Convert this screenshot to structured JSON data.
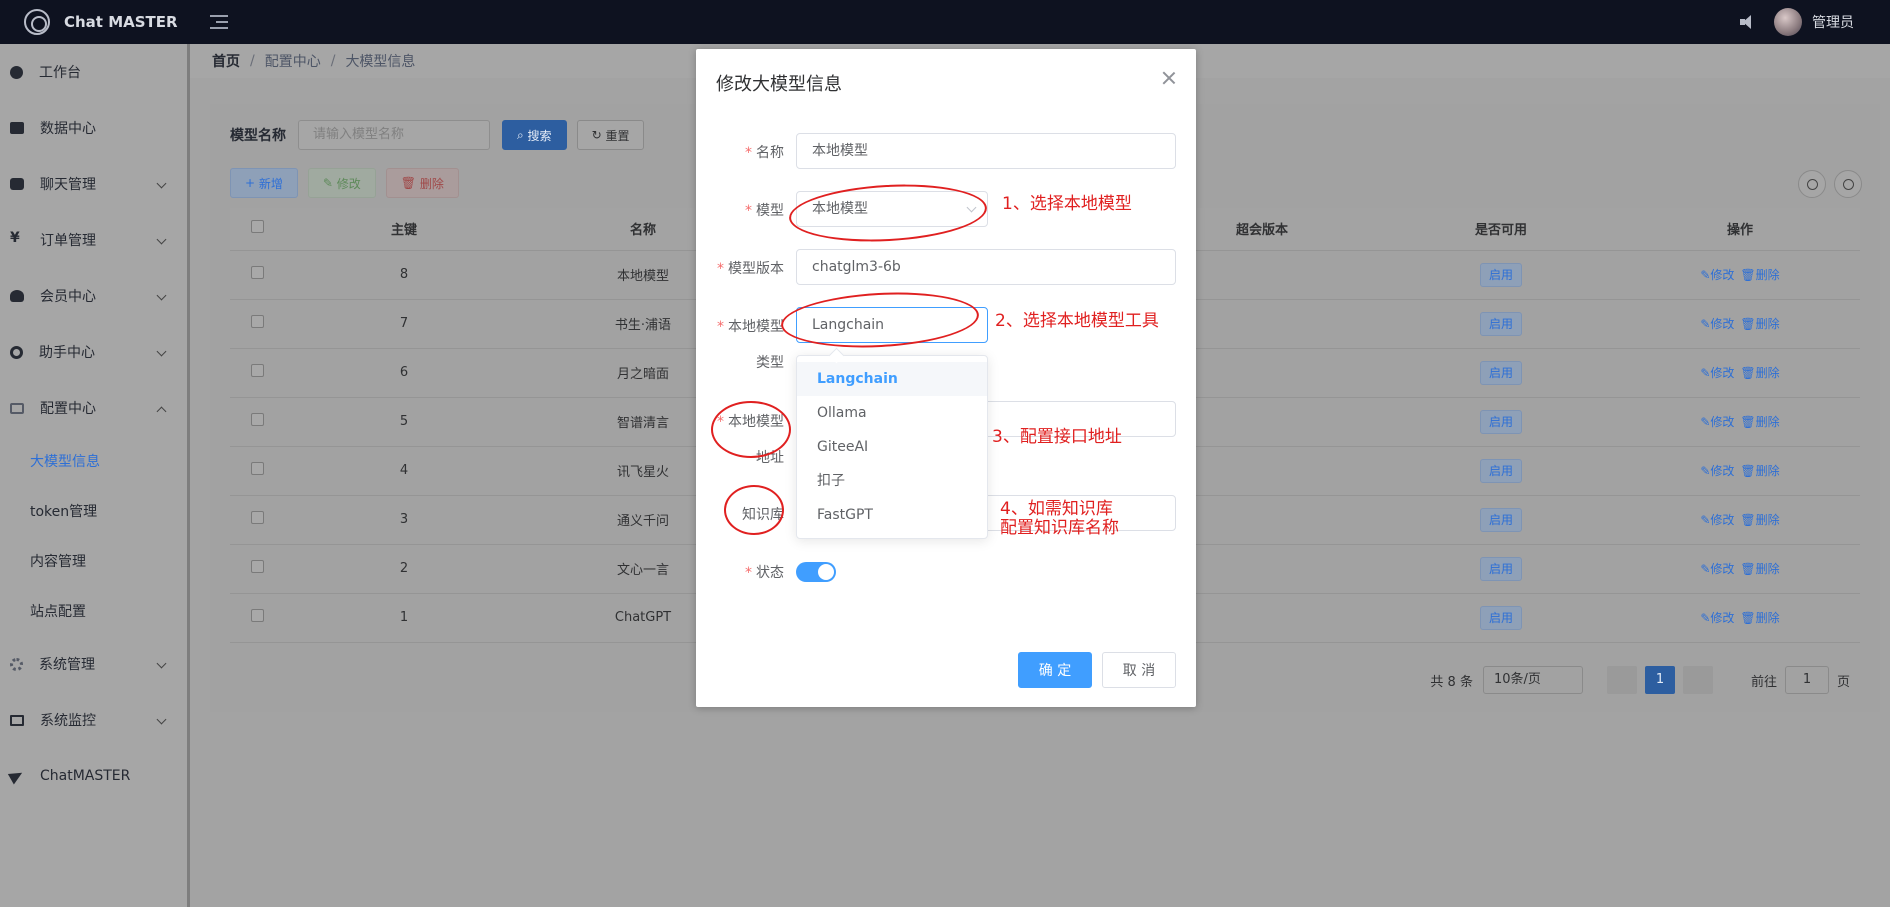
{
  "app": {
    "title": "Chat MASTER",
    "user": "管理员"
  },
  "sidebar": {
    "items": [
      {
        "label": "工作台"
      },
      {
        "label": "数据中心"
      },
      {
        "label": "聊天管理"
      },
      {
        "label": "订单管理"
      },
      {
        "label": "会员中心"
      },
      {
        "label": "助手中心"
      },
      {
        "label": "配置中心"
      },
      {
        "label": "系统管理"
      },
      {
        "label": "系统监控"
      },
      {
        "label": "ChatMASTER"
      }
    ],
    "sub_items": [
      {
        "label": "大模型信息"
      },
      {
        "label": "token管理"
      },
      {
        "label": "内容管理"
      },
      {
        "label": "站点配置"
      }
    ]
  },
  "breadcrumb": {
    "home": "首页",
    "section": "配置中心",
    "current": "大模型信息"
  },
  "search": {
    "label": "模型名称",
    "placeholder": "请输入模型名称",
    "search_btn": "搜索",
    "reset_btn": "重置"
  },
  "actions": {
    "add": "新增",
    "edit": "修改",
    "delete": "删除"
  },
  "table": {
    "headers": [
      "主键",
      "名称",
      "超会版本",
      "是否可用",
      "操作"
    ],
    "rows": [
      {
        "id": "8",
        "name": "本地模型",
        "status": "启用"
      },
      {
        "id": "7",
        "name": "书生·浦语",
        "status": "启用"
      },
      {
        "id": "6",
        "name": "月之暗面",
        "status": "启用"
      },
      {
        "id": "5",
        "name": "智谱清言",
        "status": "启用"
      },
      {
        "id": "4",
        "name": "讯飞星火",
        "status": "启用"
      },
      {
        "id": "3",
        "name": "通义千问",
        "status": "启用"
      },
      {
        "id": "2",
        "name": "文心一言",
        "status": "启用"
      },
      {
        "id": "1",
        "name": "ChatGPT",
        "status": "启用"
      }
    ],
    "op_edit": "修改",
    "op_delete": "删除"
  },
  "pager": {
    "total": "共 8 条",
    "size": "10条/页",
    "page": "1",
    "goto_label": "前往",
    "goto_value": "1",
    "goto_suffix": "页"
  },
  "dialog": {
    "title": "修改大模型信息",
    "fields": {
      "name_label": "名称",
      "name_value": "本地模型",
      "model_label": "模型",
      "model_value": "本地模型",
      "version_label": "模型版本",
      "version_value": "chatglm3-6b",
      "local_type_label1": "本地模型",
      "local_type_label2": "类型",
      "local_type_value": "Langchain",
      "local_addr_label1": "本地模型",
      "local_addr_label2": "地址",
      "kb_label": "知识库",
      "status_label": "状态"
    },
    "dropdown_options": [
      "Langchain",
      "Ollama",
      "GiteeAI",
      "扣子",
      "FastGPT"
    ],
    "ok": "确 定",
    "cancel": "取 消"
  },
  "annotations": {
    "a1": "1、选择本地模型",
    "a2": "2、选择本地模型工具",
    "a3": "3、配置接口地址",
    "a4_line1": "4、如需知识库",
    "a4_line2": "配置知识库名称",
    "color": "#e02020"
  }
}
